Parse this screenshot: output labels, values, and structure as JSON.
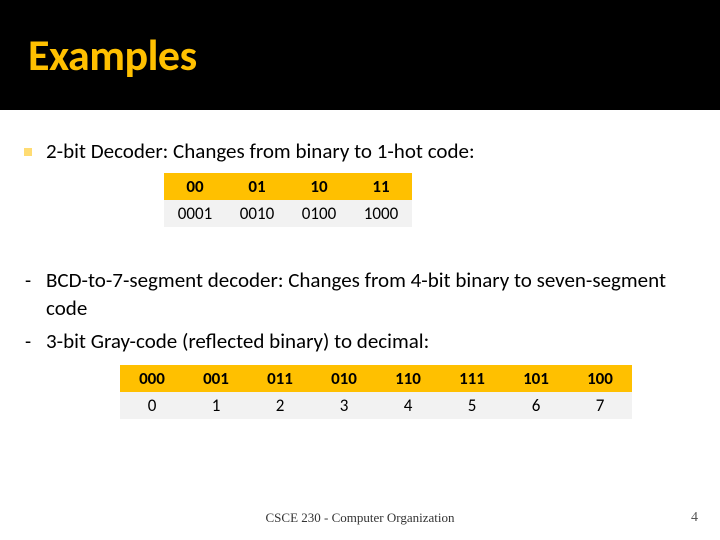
{
  "title": "Examples",
  "bullets": {
    "b1": "2-bit Decoder: Changes from binary to 1-hot code:",
    "b2": "BCD-to-7-segment decoder: Changes from 4-bit binary to seven-segment code",
    "b3": "3-bit Gray-code (reflected binary) to decimal:"
  },
  "table1": {
    "headers": [
      "00",
      "01",
      "10",
      "11"
    ],
    "row": [
      "0001",
      "0010",
      "0100",
      "1000"
    ]
  },
  "table2": {
    "headers": [
      "000",
      "001",
      "011",
      "010",
      "110",
      "111",
      "101",
      "100"
    ],
    "row": [
      "0",
      "1",
      "2",
      "3",
      "4",
      "5",
      "6",
      "7"
    ]
  },
  "footer": {
    "center": "CSCE 230 - Computer Organization",
    "page": "4"
  },
  "colors": {
    "accent": "#ffc000",
    "title_bg": "#000000",
    "cell_bg": "#f2f2f2"
  }
}
